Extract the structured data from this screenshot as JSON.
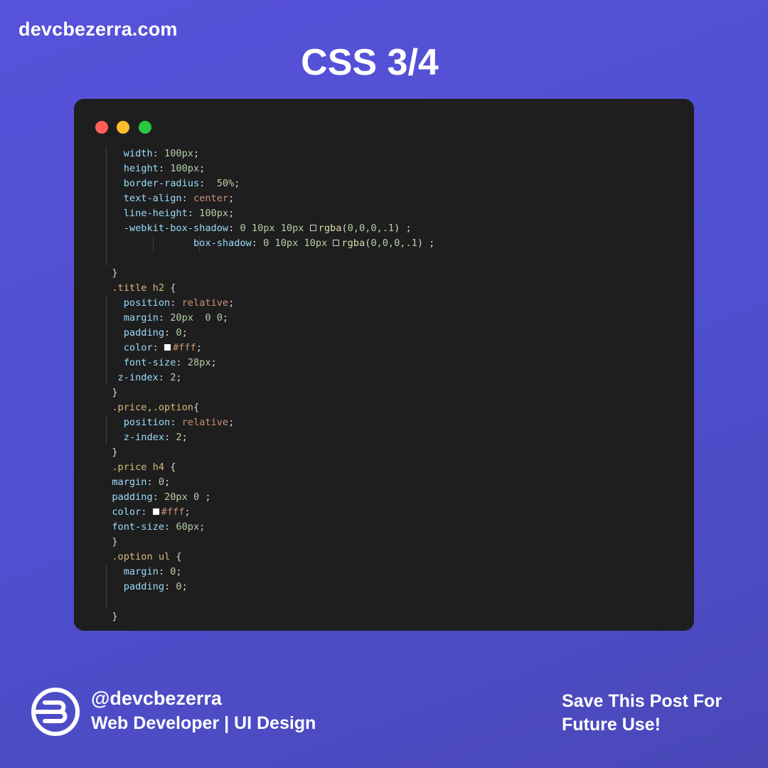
{
  "header": {
    "site": "devcbezerra.com",
    "title": "CSS 3/4"
  },
  "window": {
    "dot_colors": [
      "#fe5f57",
      "#febc2e",
      "#28c840"
    ]
  },
  "code": {
    "lines": [
      {
        "guides": [
          1
        ],
        "tokens": [
          {
            "t": "    "
          },
          {
            "t": "width",
            "c": "p"
          },
          {
            "t": ": "
          },
          {
            "t": "100px",
            "c": "n"
          },
          {
            "t": ";"
          }
        ]
      },
      {
        "guides": [
          1
        ],
        "tokens": [
          {
            "t": "    "
          },
          {
            "t": "height",
            "c": "p"
          },
          {
            "t": ": "
          },
          {
            "t": "100px",
            "c": "n"
          },
          {
            "t": ";"
          }
        ]
      },
      {
        "guides": [
          1
        ],
        "tokens": [
          {
            "t": "    "
          },
          {
            "t": "border-radius",
            "c": "p"
          },
          {
            "t": ":  "
          },
          {
            "t": "50%",
            "c": "n"
          },
          {
            "t": ";"
          }
        ]
      },
      {
        "guides": [
          1
        ],
        "tokens": [
          {
            "t": "    "
          },
          {
            "t": "text-align",
            "c": "p"
          },
          {
            "t": ": "
          },
          {
            "t": "center",
            "c": "v"
          },
          {
            "t": ";"
          }
        ]
      },
      {
        "guides": [
          1
        ],
        "tokens": [
          {
            "t": "    "
          },
          {
            "t": "line-height",
            "c": "p"
          },
          {
            "t": ": "
          },
          {
            "t": "100px",
            "c": "n"
          },
          {
            "t": ";"
          }
        ]
      },
      {
        "guides": [
          1
        ],
        "tokens": [
          {
            "t": "    "
          },
          {
            "t": "-webkit-box-shadow",
            "c": "p"
          },
          {
            "t": ": "
          },
          {
            "t": "0 10px 10px ",
            "c": "n"
          },
          {
            "sw": "outline"
          },
          {
            "t": "rgba",
            "c": "f"
          },
          {
            "t": "(",
            "c": "b"
          },
          {
            "t": "0,0,0,.1",
            "c": "n"
          },
          {
            "t": ") ;"
          }
        ]
      },
      {
        "guides": [
          1,
          9,
          17
        ],
        "tokens": [
          {
            "t": "                "
          },
          {
            "t": "box-shadow",
            "c": "p"
          },
          {
            "t": ": "
          },
          {
            "t": "0 10px 10px ",
            "c": "n"
          },
          {
            "sw": "outline"
          },
          {
            "t": "rgba",
            "c": "f"
          },
          {
            "t": "(",
            "c": "b"
          },
          {
            "t": "0,0,0,.1",
            "c": "n"
          },
          {
            "t": ") ;"
          }
        ]
      },
      {
        "guides": [
          1
        ],
        "tokens": [
          {
            "t": ""
          }
        ]
      },
      {
        "guides": [],
        "tokens": [
          {
            "t": "  }"
          }
        ]
      },
      {
        "guides": [],
        "tokens": [
          {
            "t": "  "
          },
          {
            "t": ".title h2",
            "c": "s"
          },
          {
            "t": " {"
          }
        ]
      },
      {
        "guides": [
          1
        ],
        "tokens": [
          {
            "t": "    "
          },
          {
            "t": "position",
            "c": "p"
          },
          {
            "t": ": "
          },
          {
            "t": "relative",
            "c": "v"
          },
          {
            "t": ";"
          }
        ]
      },
      {
        "guides": [
          1
        ],
        "tokens": [
          {
            "t": "    "
          },
          {
            "t": "margin",
            "c": "p"
          },
          {
            "t": ": "
          },
          {
            "t": "20px  0 0",
            "c": "n"
          },
          {
            "t": ";"
          }
        ]
      },
      {
        "guides": [
          1
        ],
        "tokens": [
          {
            "t": "    "
          },
          {
            "t": "padding",
            "c": "p"
          },
          {
            "t": ": "
          },
          {
            "t": "0",
            "c": "n"
          },
          {
            "t": ";"
          }
        ]
      },
      {
        "guides": [
          1
        ],
        "tokens": [
          {
            "t": "    "
          },
          {
            "t": "color",
            "c": "p"
          },
          {
            "t": ": "
          },
          {
            "sw": "white"
          },
          {
            "t": "#fff",
            "c": "v"
          },
          {
            "t": ";"
          }
        ]
      },
      {
        "guides": [
          1
        ],
        "tokens": [
          {
            "t": "    "
          },
          {
            "t": "font-size",
            "c": "p"
          },
          {
            "t": ": "
          },
          {
            "t": "28px",
            "c": "n"
          },
          {
            "t": ";"
          }
        ]
      },
      {
        "guides": [
          1
        ],
        "tokens": [
          {
            "t": "   "
          },
          {
            "t": "z-index",
            "c": "p"
          },
          {
            "t": ": "
          },
          {
            "t": "2",
            "c": "n"
          },
          {
            "t": ";"
          }
        ]
      },
      {
        "guides": [],
        "tokens": [
          {
            "t": "  }"
          }
        ]
      },
      {
        "guides": [],
        "tokens": [
          {
            "t": "  "
          },
          {
            "t": ".price,.option",
            "c": "s"
          },
          {
            "t": "{"
          }
        ]
      },
      {
        "guides": [
          1
        ],
        "tokens": [
          {
            "t": "    "
          },
          {
            "t": "position",
            "c": "p"
          },
          {
            "t": ": "
          },
          {
            "t": "relative",
            "c": "v"
          },
          {
            "t": ";"
          }
        ]
      },
      {
        "guides": [
          1
        ],
        "tokens": [
          {
            "t": "    "
          },
          {
            "t": "z-index",
            "c": "p"
          },
          {
            "t": ": "
          },
          {
            "t": "2",
            "c": "n"
          },
          {
            "t": ";"
          }
        ]
      },
      {
        "guides": [],
        "tokens": [
          {
            "t": "  }"
          }
        ]
      },
      {
        "guides": [],
        "tokens": [
          {
            "t": "  "
          },
          {
            "t": ".price h4",
            "c": "s"
          },
          {
            "t": " {"
          }
        ]
      },
      {
        "guides": [],
        "tokens": [
          {
            "t": "  "
          },
          {
            "t": "margin",
            "c": "p"
          },
          {
            "t": ": "
          },
          {
            "t": "0",
            "c": "n"
          },
          {
            "t": ";"
          }
        ]
      },
      {
        "guides": [],
        "tokens": [
          {
            "t": "  "
          },
          {
            "t": "padding",
            "c": "p"
          },
          {
            "t": ": "
          },
          {
            "t": "20px 0",
            "c": "n"
          },
          {
            "t": " ;"
          }
        ]
      },
      {
        "guides": [],
        "tokens": [
          {
            "t": "  "
          },
          {
            "t": "color",
            "c": "p"
          },
          {
            "t": ": "
          },
          {
            "sw": "white"
          },
          {
            "t": "#fff",
            "c": "v"
          },
          {
            "t": ";"
          }
        ]
      },
      {
        "guides": [],
        "tokens": [
          {
            "t": "  "
          },
          {
            "t": "font-size",
            "c": "p"
          },
          {
            "t": ": "
          },
          {
            "t": "60px",
            "c": "n"
          },
          {
            "t": ";"
          }
        ]
      },
      {
        "guides": [],
        "tokens": [
          {
            "t": "  }"
          }
        ]
      },
      {
        "guides": [],
        "tokens": [
          {
            "t": "  "
          },
          {
            "t": ".option ul",
            "c": "s"
          },
          {
            "t": " {"
          }
        ]
      },
      {
        "guides": [
          1
        ],
        "tokens": [
          {
            "t": "    "
          },
          {
            "t": "margin",
            "c": "p"
          },
          {
            "t": ": "
          },
          {
            "t": "0",
            "c": "n"
          },
          {
            "t": ";"
          }
        ]
      },
      {
        "guides": [
          1
        ],
        "tokens": [
          {
            "t": "    "
          },
          {
            "t": "padding",
            "c": "p"
          },
          {
            "t": ": "
          },
          {
            "t": "0",
            "c": "n"
          },
          {
            "t": ";"
          }
        ]
      },
      {
        "guides": [
          1
        ],
        "tokens": [
          {
            "t": ""
          }
        ]
      },
      {
        "guides": [],
        "tokens": [
          {
            "t": "  }"
          }
        ]
      }
    ]
  },
  "footer": {
    "logo_icon": "devcbezerra-logo-icon",
    "handle": "@devcbezerra",
    "role": "Web Developer | UI Design",
    "cta_line1": "Save This Post For",
    "cta_line2": "Future Use!"
  }
}
